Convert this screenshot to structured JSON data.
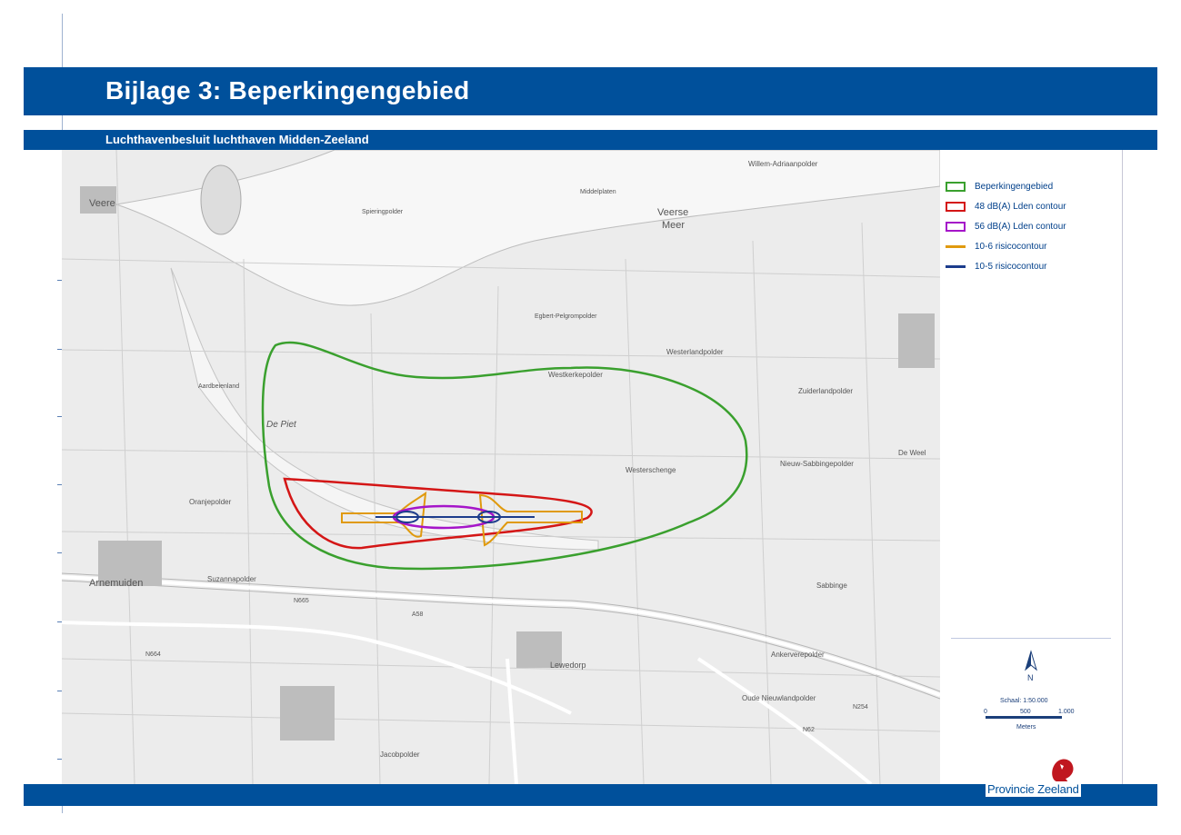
{
  "title": "Bijlage 3: Beperkingengebied",
  "subtitle": "Luchthavenbesluit luchthaven Midden-Zeeland",
  "legend": [
    {
      "label": "Beperkingengebied",
      "color": "#3aa02e",
      "kind": "box"
    },
    {
      "label": "48 dB(A) Lden contour",
      "color": "#d41616",
      "kind": "box"
    },
    {
      "label": "56 dB(A) Lden contour",
      "color": "#a515c9",
      "kind": "box"
    },
    {
      "label": "10-6 risicocontour",
      "color": "#e09a0e",
      "kind": "line"
    },
    {
      "label": "10-5 risicocontour",
      "color": "#1c3c8c",
      "kind": "line"
    }
  ],
  "north_label": "N",
  "scale": {
    "text": "Schaal:  1:50.000",
    "ticks": [
      "0",
      "500",
      "1.000"
    ],
    "unit": "Meters"
  },
  "logo_text": "Provincie Zeeland",
  "map_labels": {
    "veere": "Veere",
    "veerse_meer": "Veerse",
    "veerse_meer2": "Meer",
    "arnemuiden": "Arnemuiden",
    "lewedorp": "Lewedorp",
    "westerlandpolder": "Westerlandpolder",
    "westkerkepolder": "Westkerkepolder",
    "zuiderlandpolder": "Zuiderlandpolder",
    "egbert": "Egbert-Pelgrompolder",
    "spieringpolder": "Spieringpolder",
    "aardbeienland": "Aardbeienland",
    "oranjepolder": "Oranjepolder",
    "suzannapolder": "Suzannapolder",
    "jacobpolder": "Jacobpolder",
    "ankerverepolder": "Ankerverepolder",
    "oude_nieuwland": "Oude Nieuwlandpolder",
    "nieuw_sabbinge": "Nieuw-Sabbingepolder",
    "willem_adriaan": "Willem-Adriaanpolder",
    "de_piet": "De Piet",
    "middelplaten": "Middelplaten",
    "westerschenge": "Westerschenge",
    "sabbinge": "Sabbinge",
    "de_weel": "De Weel",
    "n665": "N665",
    "n664": "N664",
    "n254": "N254",
    "n62": "N62",
    "a58": "A58"
  }
}
